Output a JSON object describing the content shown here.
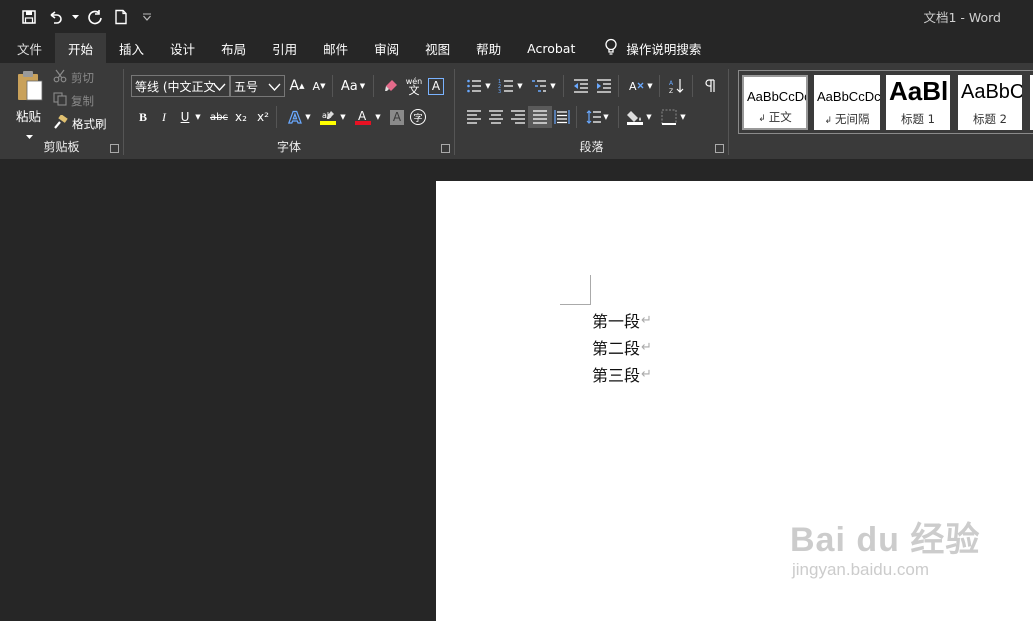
{
  "window": {
    "title": "文档1  -  Word"
  },
  "qat": {
    "icons": [
      "save-icon",
      "undo-icon",
      "redo-icon",
      "new-doc-icon",
      "customize-qat-icon"
    ]
  },
  "tabs": [
    {
      "label": "文件",
      "active": false
    },
    {
      "label": "开始",
      "active": true
    },
    {
      "label": "插入",
      "active": false
    },
    {
      "label": "设计",
      "active": false
    },
    {
      "label": "布局",
      "active": false
    },
    {
      "label": "引用",
      "active": false
    },
    {
      "label": "邮件",
      "active": false
    },
    {
      "label": "审阅",
      "active": false
    },
    {
      "label": "视图",
      "active": false
    },
    {
      "label": "帮助",
      "active": false
    },
    {
      "label": "Acrobat",
      "active": false
    }
  ],
  "tell_me": {
    "label": "操作说明搜索"
  },
  "clipboard": {
    "paste": "粘贴",
    "cut": "剪切",
    "copy": "复制",
    "format_painter": "格式刷",
    "group_label": "剪贴板"
  },
  "font": {
    "font_name": "等线 (中文正文)",
    "font_size": "五号",
    "change_case": "Aa",
    "bold": "B",
    "italic": "I",
    "underline": "U",
    "strikethrough": "abc",
    "subscript": "x₂",
    "superscript": "x²",
    "phonetic": "wén",
    "phonetic_char": "文",
    "char_border": "A",
    "char_shading": "A",
    "enclose_char": "字",
    "group_label": "字体",
    "highlight_color": "#ffff00",
    "font_color": "#e81123"
  },
  "paragraph": {
    "group_label": "段落"
  },
  "styles": [
    {
      "sample": "AaBbCcDc",
      "name": "正文",
      "selected": true
    },
    {
      "sample": "AaBbCcDc",
      "name": "无间隔",
      "selected": false
    },
    {
      "sample": "AaBl",
      "name": "标题 1",
      "selected": false
    },
    {
      "sample": "AaBbC",
      "name": "标题 2",
      "selected": false
    }
  ],
  "document": {
    "paragraphs": [
      "第一段",
      "第二段",
      "第三段"
    ],
    "paragraph_mark": "↵"
  },
  "watermark": {
    "line1": "Bai du 经验",
    "line2": "jingyan.baidu.com"
  }
}
